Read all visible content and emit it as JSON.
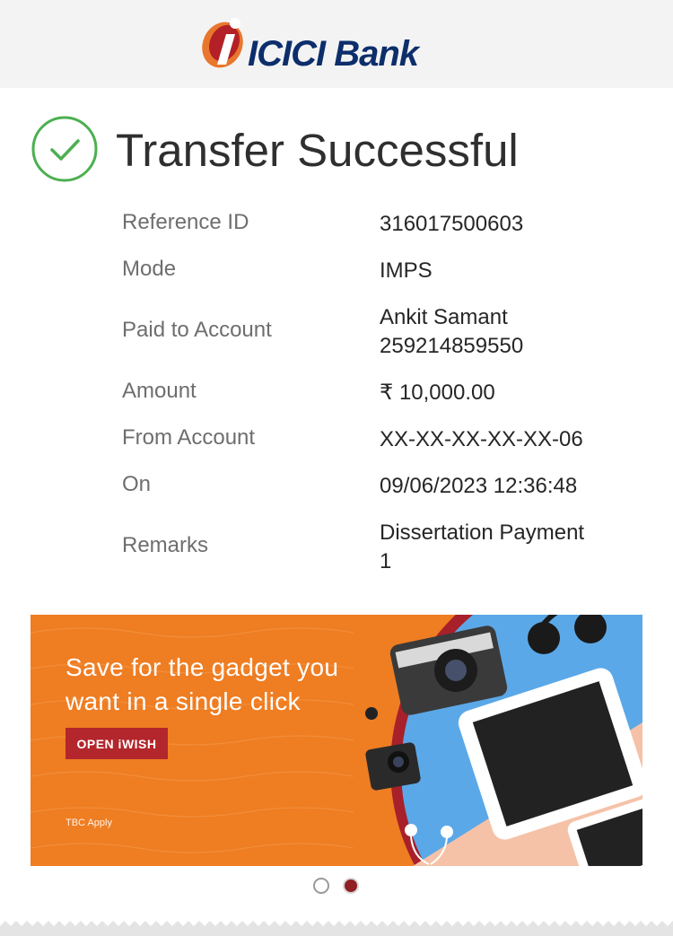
{
  "header": {
    "logo_text": "ICICI Bank",
    "logo_icon": "icici-logo-mark"
  },
  "status": {
    "title": "Transfer Successful",
    "icon": "check-circle-icon",
    "accent": "#4caf50"
  },
  "details": [
    {
      "label": "Reference ID",
      "value": "316017500603"
    },
    {
      "label": "Mode",
      "value": "IMPS"
    },
    {
      "label": "Paid to Account",
      "value": "Ankit Samant",
      "value2": "259214859550"
    },
    {
      "label": "Amount",
      "value": "₹ 10,000.00"
    },
    {
      "label": "From Account",
      "value": "XX-XX-XX-XX-XX-06"
    },
    {
      "label": "On",
      "value": "09/06/2023 12:36:48"
    },
    {
      "label": "Remarks",
      "value": "Dissertation Payment",
      "value2": "1"
    }
  ],
  "banner": {
    "line1": "Save for the gadget you",
    "line2": "want in a single click",
    "button_label": "OPEN iWISH",
    "tbc": "TBC Apply",
    "bg_color": "#ef7d22",
    "button_color": "#b3262c"
  },
  "carousel": {
    "total": 2,
    "active": 2
  }
}
